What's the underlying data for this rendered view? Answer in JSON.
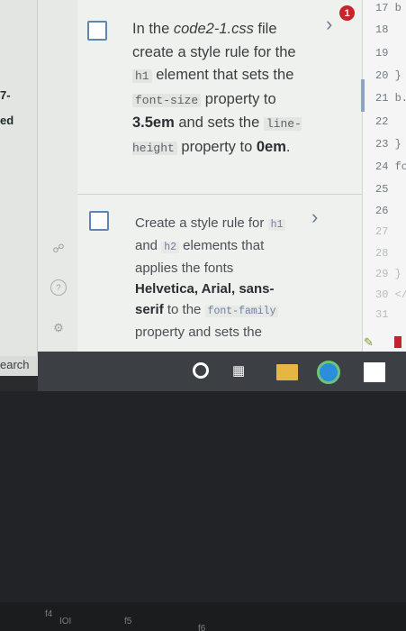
{
  "left_edge": {
    "line1": "7-",
    "line2": "ed"
  },
  "badge": {
    "count": "1"
  },
  "tasks": [
    {
      "t1": "In the ",
      "file": "code2-1.css",
      "t2": " file create a style rule for the ",
      "code1": "h1",
      "t3": " element that sets the ",
      "code2": "font-size",
      "t4": " property to ",
      "val1": "3.5em",
      "t5": " and sets the ",
      "code3": "line-height",
      "t6": " property to ",
      "val2": "0em",
      "t7": "."
    },
    {
      "t1": "Create a style rule for ",
      "code1": "h1",
      "t2": " and ",
      "code2": "h2",
      "t3": " elements that applies the fonts ",
      "fonts": "Helvetica, Arial, sans-serif",
      "t4": " to the ",
      "code3": "font-family",
      "t5": " property and sets the"
    }
  ],
  "editor_lines": [
    {
      "text": "17 b"
    },
    {
      "text": "18"
    },
    {
      "text": "19"
    },
    {
      "text": "20 }"
    },
    {
      "text": "21 b."
    },
    {
      "text": "22"
    },
    {
      "text": "23 }"
    },
    {
      "text": "24 fo"
    },
    {
      "text": "25"
    },
    {
      "text": "26"
    },
    {
      "text": "27"
    },
    {
      "text": "28"
    },
    {
      "text": "29 }"
    },
    {
      "text": "30 </s"
    },
    {
      "text": "31"
    }
  ],
  "search": {
    "label": "earch"
  },
  "keyboard": {
    "k1": "f4",
    "k2": "IOI",
    "k3": "f5",
    "k4": "f6"
  }
}
